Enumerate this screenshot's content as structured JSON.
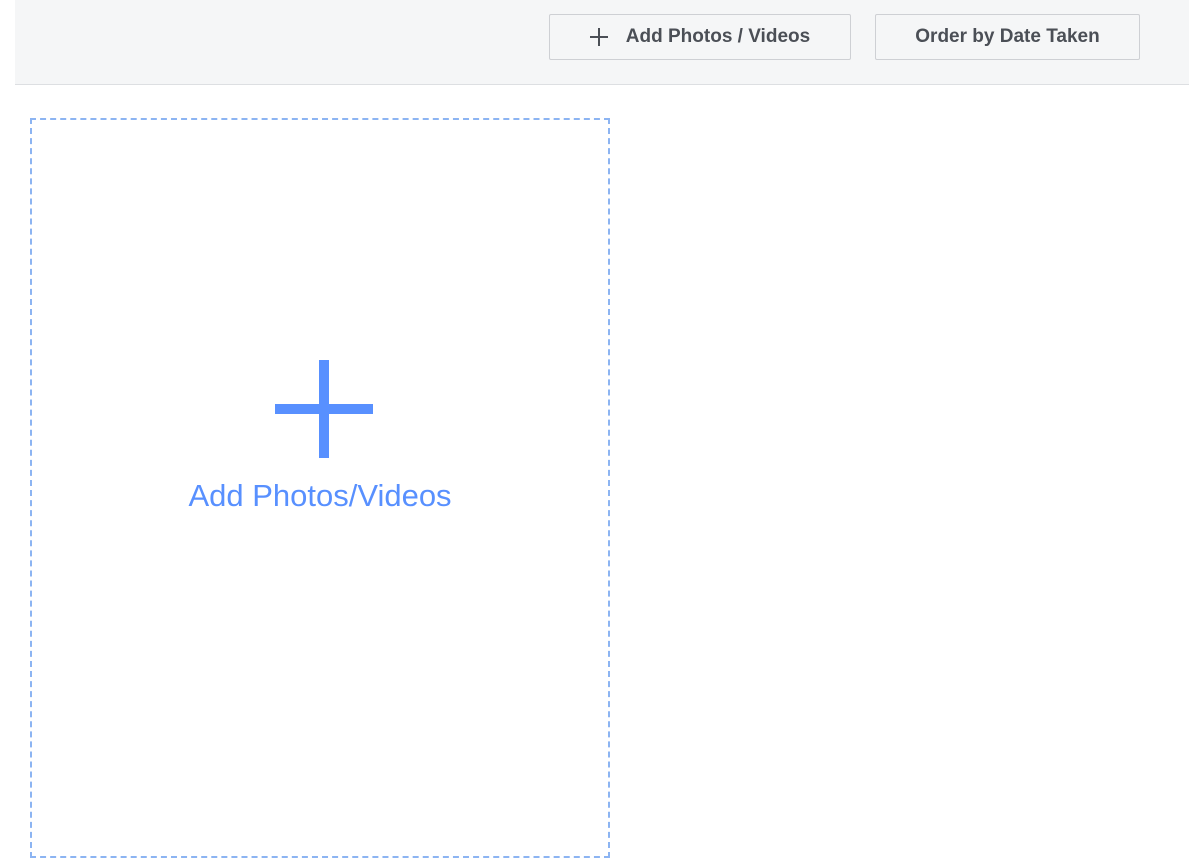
{
  "toolbar": {
    "add_button_label": "Add Photos / Videos",
    "add_button_icon": "plus-icon",
    "order_button_label": "Order by Date Taken"
  },
  "dropzone": {
    "icon": "plus-icon",
    "label": "Add Photos/Videos"
  },
  "colors": {
    "accent": "#5890ff",
    "dashed_border": "#8cb4f2",
    "toolbar_bg": "#f5f6f7",
    "button_text": "#4b4f56"
  }
}
